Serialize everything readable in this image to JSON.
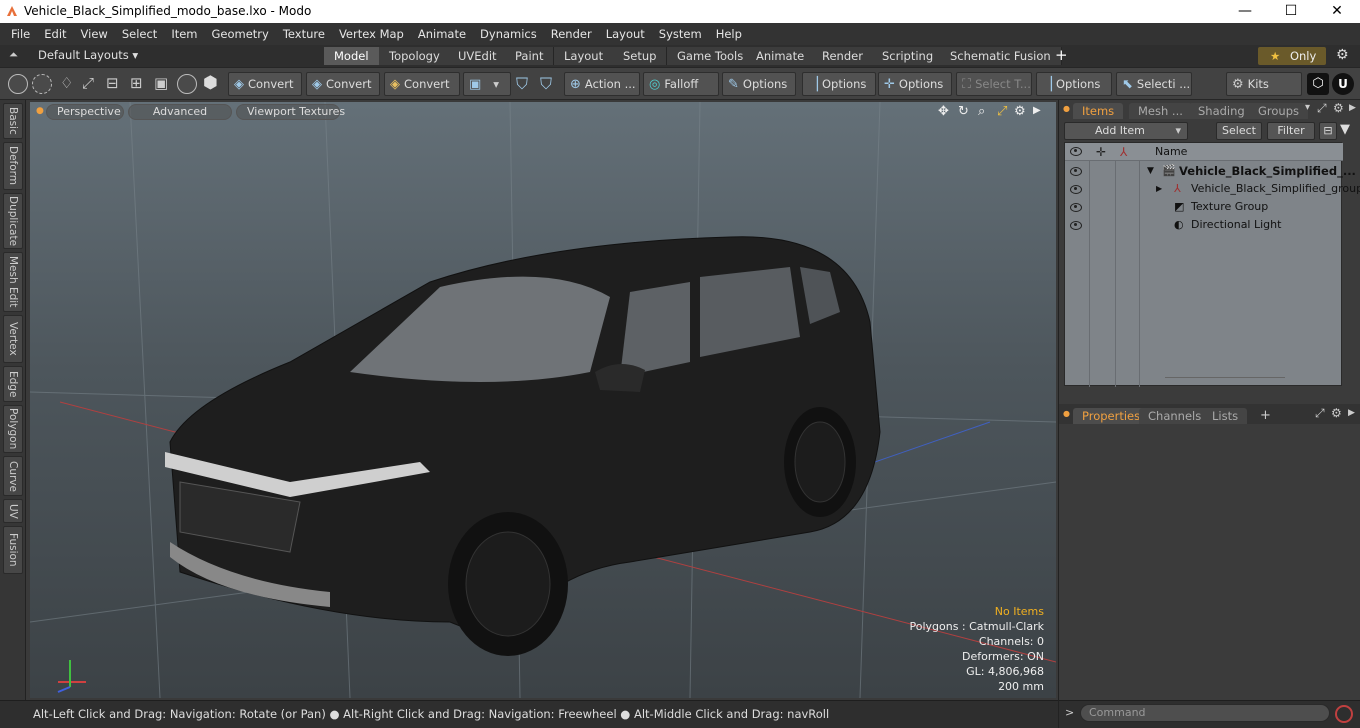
{
  "window": {
    "title": "Vehicle_Black_Simplified_modo_base.lxo - Modo",
    "min": "—",
    "max": "☐",
    "close": "✕"
  },
  "menu": [
    "File",
    "Edit",
    "View",
    "Select",
    "Item",
    "Geometry",
    "Texture",
    "Vertex Map",
    "Animate",
    "Dynamics",
    "Render",
    "Layout",
    "System",
    "Help"
  ],
  "layouts": {
    "label": "Default Layouts ▾",
    "tabs": [
      "Model",
      "Topology",
      "UVEdit",
      "Paint",
      "Layout",
      "Setup",
      "Game Tools",
      "Animate",
      "Render",
      "Scripting",
      "Schematic Fusion"
    ],
    "active": "Model",
    "add": "+",
    "only": "Only"
  },
  "toolbar": {
    "convert1": "Convert",
    "convert2": "Convert",
    "convert3": "Convert",
    "action": "Action ...",
    "falloff": "Falloff",
    "options1": "Options",
    "options2": "Options",
    "options3": "Options",
    "select_t": "Select T...",
    "options4": "Options",
    "selecti": "Selecti ...",
    "kits": "Kits"
  },
  "left_tabs": [
    "Basic",
    "Deform",
    "Duplicate",
    "Mesh Edit",
    "Vertex",
    "Edge",
    "Polygon",
    "Curve",
    "UV",
    "Fusion"
  ],
  "viewport": {
    "view": "Perspective",
    "advanced": "Advanced",
    "textures": "Viewport Textures",
    "stats": {
      "items": "No Items",
      "polygons": "Polygons : Catmull-Clark",
      "channels": "Channels: 0",
      "deformers": "Deformers: ON",
      "gl": "GL: 4,806,968",
      "scale": "200 mm"
    },
    "items_color": "#f0b020"
  },
  "status": "Alt-Left Click and Drag: Navigation: Rotate (or Pan) ● Alt-Right Click and Drag: Navigation: Freewheel ● Alt-Middle Click and Drag: navRoll",
  "right": {
    "tabs": [
      "Items",
      "Mesh ...",
      "Shading",
      "Groups"
    ],
    "add_item": "Add Item",
    "select": "Select",
    "filter": "Filter",
    "name_col": "Name",
    "tree": [
      {
        "name": "Vehicle_Black_Simplified_...",
        "icon": "scene-icon"
      },
      {
        "name": "Vehicle_Black_Simplified_group",
        "icon": "group-locator-icon"
      },
      {
        "name": "Texture Group",
        "icon": "texture-group-icon"
      },
      {
        "name": "Directional Light",
        "icon": "light-icon"
      }
    ],
    "lower_tabs": [
      "Properties",
      "Channels",
      "Lists"
    ],
    "lower_add": "+",
    "command_placeholder": "Command",
    "accent": "#f0a040"
  }
}
